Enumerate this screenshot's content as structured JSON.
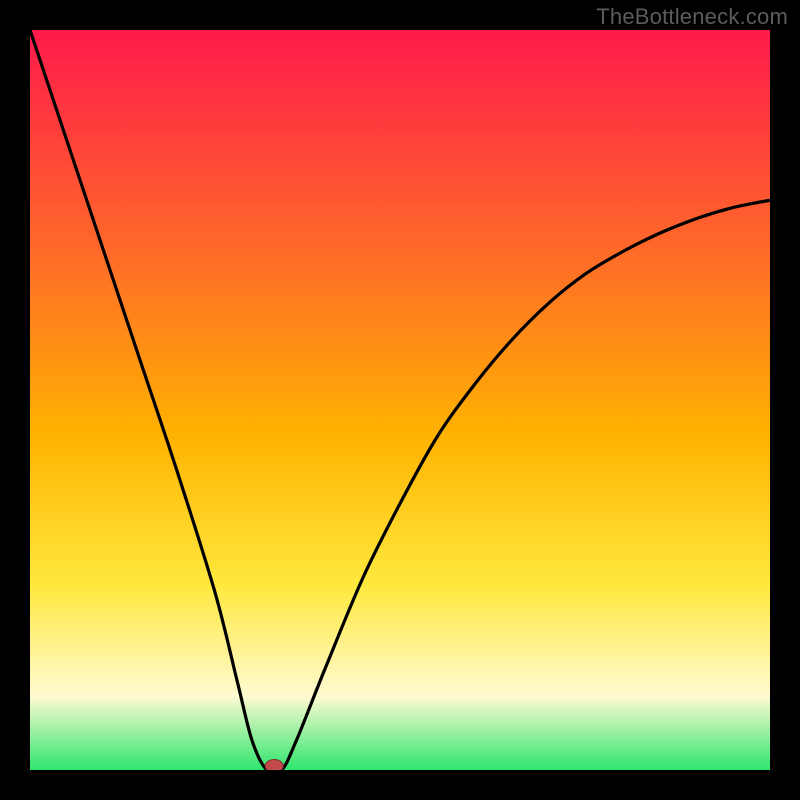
{
  "watermark": "TheBottleneck.com",
  "colors": {
    "frame_bg": "#000000",
    "watermark_text": "#5c5c5c",
    "gradient_top": "#ff1a4b",
    "gradient_mid_upper": "#ff6a29",
    "gradient_mid": "#ffb300",
    "gradient_mid_lower": "#ffe83d",
    "gradient_lower": "#fffad1",
    "gradient_bottom": "#2fe66f",
    "curve_stroke": "#000000",
    "marker_fill": "#c24a4a",
    "marker_stroke": "#7a2f2f"
  },
  "chart_data": {
    "type": "line",
    "title": "",
    "xlabel": "",
    "ylabel": "",
    "xlim": [
      0,
      100
    ],
    "ylim": [
      0,
      100
    ],
    "grid": false,
    "legend": false,
    "series": [
      {
        "name": "bottleneck-curve",
        "x": [
          0,
          5,
          10,
          15,
          20,
          25,
          28,
          30,
          32,
          34,
          36,
          40,
          45,
          50,
          55,
          60,
          65,
          70,
          75,
          80,
          85,
          90,
          95,
          100
        ],
        "y": [
          100,
          85,
          70,
          55,
          40,
          24,
          12,
          4,
          0,
          0,
          4,
          14,
          26,
          36,
          45,
          52,
          58,
          63,
          67,
          70,
          72.5,
          74.5,
          76,
          77
        ]
      }
    ],
    "annotations": [
      {
        "name": "valley-marker",
        "x": 33,
        "y": 0
      }
    ],
    "gradient_stops": [
      {
        "offset": 0,
        "color": "#ff1a4b"
      },
      {
        "offset": 30,
        "color": "#ff6a29"
      },
      {
        "offset": 55,
        "color": "#ffb300"
      },
      {
        "offset": 75,
        "color": "#ffe83d"
      },
      {
        "offset": 90,
        "color": "#fffad1"
      },
      {
        "offset": 100,
        "color": "#2fe66f"
      }
    ]
  }
}
